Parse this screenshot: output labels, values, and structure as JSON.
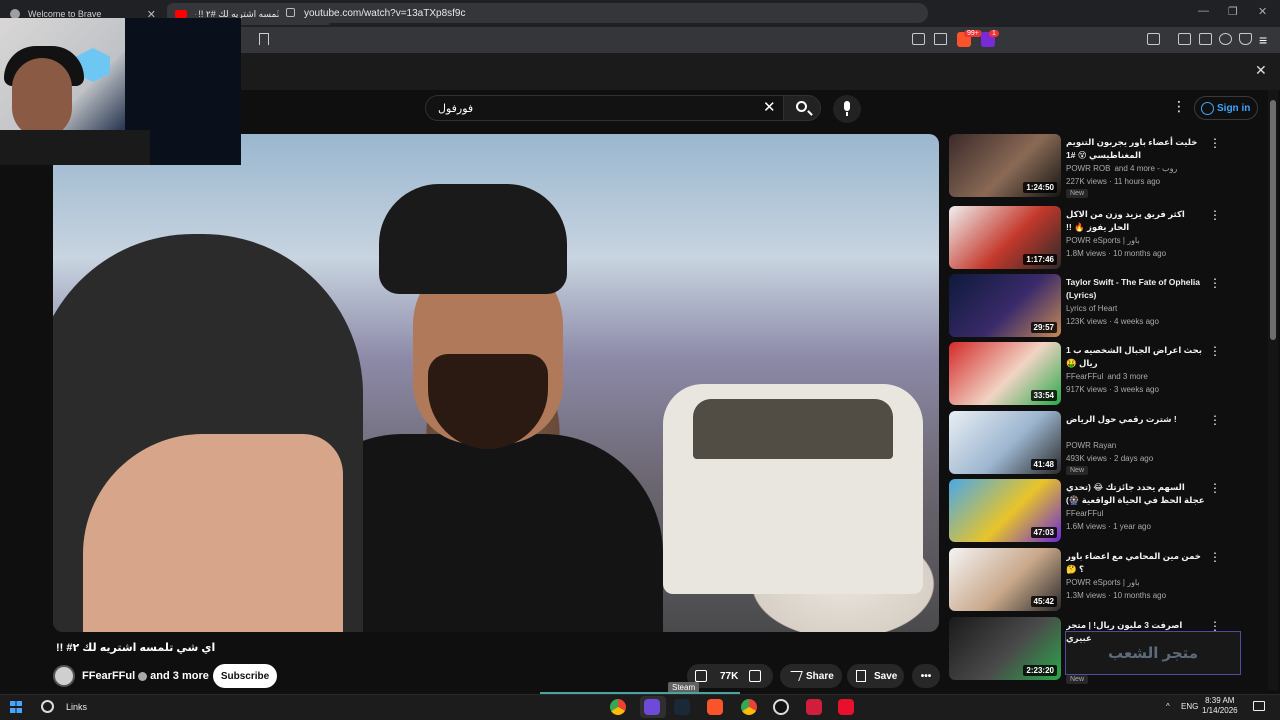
{
  "browser": {
    "tabs": [
      {
        "title": "Welcome to Brave"
      },
      {
        "title": "اي شي تلمسه اشتريه لك ‎!! ۲#‏ - YouTube"
      }
    ],
    "new_tab_label": "+",
    "url": "youtube.com/watch?v=13aTXp8sf9c",
    "badge_count": "1"
  },
  "youtube": {
    "search_query": "فورفول",
    "signin_label": "Sign in"
  },
  "video": {
    "title": "اي شي تلمسه اشتريه لك ‎#۲ !!",
    "channel": "FFearFFul",
    "channel_suffix": "and 3 more",
    "subscribe_label": "Subscribe",
    "likes": "77K",
    "share_label": "Share",
    "save_label": "Save",
    "tooltip": "Steam"
  },
  "recommendations": [
    {
      "title": "خليت أعضاء باور يجربون التنويم المغناطيسي 😵 #1",
      "channel": "POWR ROB",
      "channel_suffix": "and 4 more - روب",
      "views": "227K views · 11 hours ago",
      "badge": "New",
      "duration": "1:24:50",
      "thumb_colors": [
        "#3b2a2a",
        "#8a6a55",
        "#151515"
      ]
    },
    {
      "title": "اكثر فريق يزيد وزن من الاكل الحار يفوز 🔥 !!",
      "channel": "POWR eSports | باور",
      "channel_suffix": "",
      "views": "1.8M views · 10 months ago",
      "badge": "",
      "duration": "1:17:46",
      "thumb_colors": [
        "#f0f0f0",
        "#c4382b",
        "#2a2a2a"
      ]
    },
    {
      "title": "Taylor Swift - The Fate of Ophelia (Lyrics)",
      "channel": "Lyrics of Heart",
      "channel_suffix": "",
      "views": "123K views · 4 weeks ago",
      "badge": "",
      "duration": "29:57",
      "thumb_colors": [
        "#0d1a3a",
        "#3a2a6a",
        "#c48a55"
      ]
    },
    {
      "title": "بحث اعراض الجبال الشخصيه ب 1 ريال 🤑",
      "channel": "FFearFFul",
      "channel_suffix": "and 3 more",
      "views": "917K views · 3 weeks ago",
      "badge": "",
      "duration": "33:54",
      "thumb_colors": [
        "#d42a2a",
        "#f1d4c4",
        "#2aa84a"
      ]
    },
    {
      "title": "! شترت رقمي حول الرياض",
      "channel": "POWR Rayan",
      "channel_suffix": "",
      "views": "493K views · 2 days ago",
      "badge": "New",
      "duration": "41:48",
      "thumb_colors": [
        "#e9eef4",
        "#9cb5cf",
        "#2a2a2a"
      ]
    },
    {
      "title": "السهم يحدد جائزتك 😂 (تحدي عجلة الحظ في الحياة الواقعية 🎡)",
      "channel": "FFearFFul",
      "channel_suffix": "",
      "views": "1.6M views · 1 year ago",
      "badge": "",
      "duration": "47:03",
      "thumb_colors": [
        "#4aa8e8",
        "#e8c42a",
        "#6a2ad4"
      ]
    },
    {
      "title": "خمن مين المحامي مع اعضاء باور ؟ 🤔",
      "channel": "POWR eSports | باور",
      "channel_suffix": "",
      "views": "1.3M views · 10 months ago",
      "badge": "",
      "duration": "45:42",
      "thumb_colors": [
        "#f4f4f4",
        "#c9a88a",
        "#2a2a2a"
      ]
    },
    {
      "title": "اصرفت 3 مليون ريال! | متجر عبيري",
      "channel": "",
      "channel_suffix": "",
      "views": "",
      "badge": "New",
      "duration": "2:23:20",
      "thumb_colors": [
        "#1a1a1a",
        "#4a4a4a",
        "#2aa84a"
      ]
    }
  ],
  "watermark_text": "متجر الشعب",
  "taskbar": {
    "links_label": "Links",
    "language": "ENG",
    "time": "8:39 AM",
    "date": "1/14/2026"
  }
}
